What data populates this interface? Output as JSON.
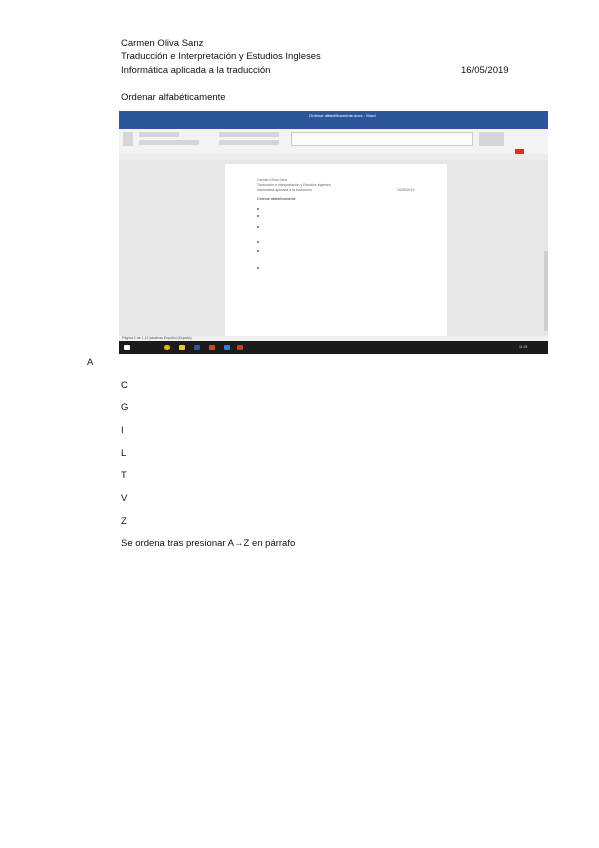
{
  "header": {
    "author": "Carmen Oliva Sanz",
    "degree": "Traducción e Interpretación y Estudios Ingleses",
    "subject": "Informática aplicada a la traducción",
    "date": "16/05/2019"
  },
  "section_title": "Ordenar alfabéticamente",
  "screenshot": {
    "window_title": "Ordenar alfabéticamente.docx - Word",
    "doc_lines": [
      "Carmen Oliva Sanz",
      "Traducción e Interpretación y Estudios Ingleses",
      "Informática aplicada a la traducción"
    ],
    "doc_date": "16/05/2019",
    "doc_heading": "Ordenar alfabéticamente",
    "status_left": "Página 1 de 1   12 palabras   Español (España)",
    "taskbar_time": "11:24"
  },
  "letters": [
    "A",
    "C",
    "G",
    "I",
    "L",
    "T",
    "V",
    "Z"
  ],
  "caption": "Se ordena tras presionar A→Z en párrafo"
}
